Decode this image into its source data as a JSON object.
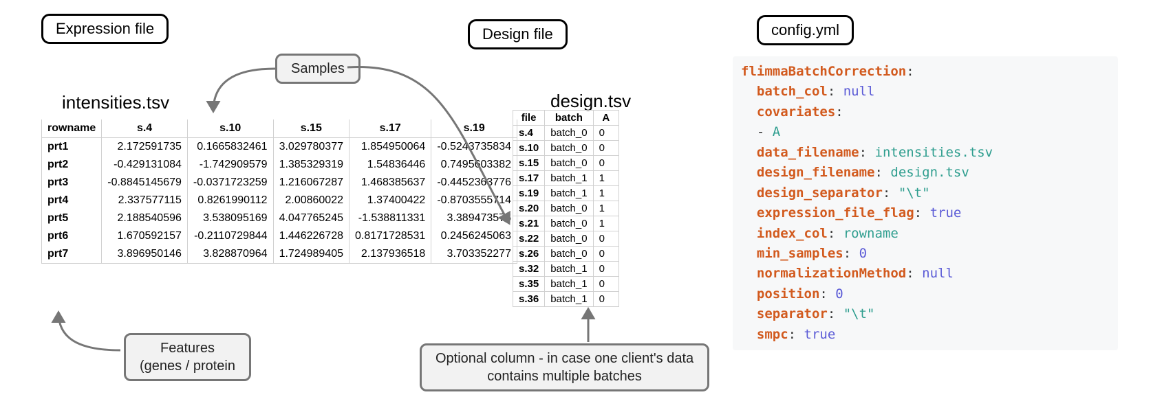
{
  "expression": {
    "badge": "Expression file",
    "filename": "intensities.tsv",
    "columns": [
      "rowname",
      "s.4",
      "s.10",
      "s.15",
      "s.17",
      "s.19"
    ],
    "rows": [
      {
        "name": "prt1",
        "vals": [
          "2.172591735",
          "0.1665832461",
          "3.029780377",
          "1.854950064",
          "-0.5243735834"
        ]
      },
      {
        "name": "prt2",
        "vals": [
          "-0.429131084",
          "-1.742909579",
          "1.385329319",
          "1.54836446",
          "0.7495603382"
        ]
      },
      {
        "name": "prt3",
        "vals": [
          "-0.8845145679",
          "-0.0371723259",
          "1.216067287",
          "1.468385637",
          "-0.4452363776"
        ]
      },
      {
        "name": "prt4",
        "vals": [
          "2.337577115",
          "0.8261990112",
          "2.00860022",
          "1.37400422",
          "-0.8703555714"
        ]
      },
      {
        "name": "prt5",
        "vals": [
          "2.188540596",
          "3.538095169",
          "4.047765245",
          "-1.538811331",
          "3.389473576"
        ]
      },
      {
        "name": "prt6",
        "vals": [
          "1.670592157",
          "-0.2110729844",
          "1.446226728",
          "0.8171728531",
          "0.2456245063"
        ]
      },
      {
        "name": "prt7",
        "vals": [
          "3.896950146",
          "3.828870964",
          "1.724989405",
          "2.137936518",
          "3.703352277"
        ]
      }
    ]
  },
  "design": {
    "badge": "Design file",
    "filename": "design.tsv",
    "columns": [
      "file",
      "batch",
      "A"
    ],
    "rows": [
      {
        "file": "s.4",
        "batch": "batch_0",
        "A": "0"
      },
      {
        "file": "s.10",
        "batch": "batch_0",
        "A": "0"
      },
      {
        "file": "s.15",
        "batch": "batch_0",
        "A": "0"
      },
      {
        "file": "s.17",
        "batch": "batch_1",
        "A": "1"
      },
      {
        "file": "s.19",
        "batch": "batch_1",
        "A": "1"
      },
      {
        "file": "s.20",
        "batch": "batch_0",
        "A": "1"
      },
      {
        "file": "s.21",
        "batch": "batch_0",
        "A": "1"
      },
      {
        "file": "s.22",
        "batch": "batch_0",
        "A": "0"
      },
      {
        "file": "s.26",
        "batch": "batch_0",
        "A": "0"
      },
      {
        "file": "s.32",
        "batch": "batch_1",
        "A": "0"
      },
      {
        "file": "s.35",
        "batch": "batch_1",
        "A": "0"
      },
      {
        "file": "s.36",
        "batch": "batch_1",
        "A": "0"
      }
    ]
  },
  "labels": {
    "samples": "Samples",
    "features_l1": "Features",
    "features_l2": "(genes / protein",
    "optional_l1": "Optional column - in case one client's data",
    "optional_l2": "contains multiple batches"
  },
  "config": {
    "badge": "config.yml",
    "yaml": {
      "topkey": "flimmaBatchCorrection",
      "batch_col": "null",
      "covariates_key": "covariates",
      "covariates_item": "A",
      "data_filename": "intensities.tsv",
      "design_filename": "design.tsv",
      "design_separator": "\"\\t\"",
      "expression_file_flag": "true",
      "index_col": "rowname",
      "min_samples": "0",
      "normalizationMethod": "null",
      "position": "0",
      "separator": "\"\\t\"",
      "smpc": "true"
    }
  }
}
